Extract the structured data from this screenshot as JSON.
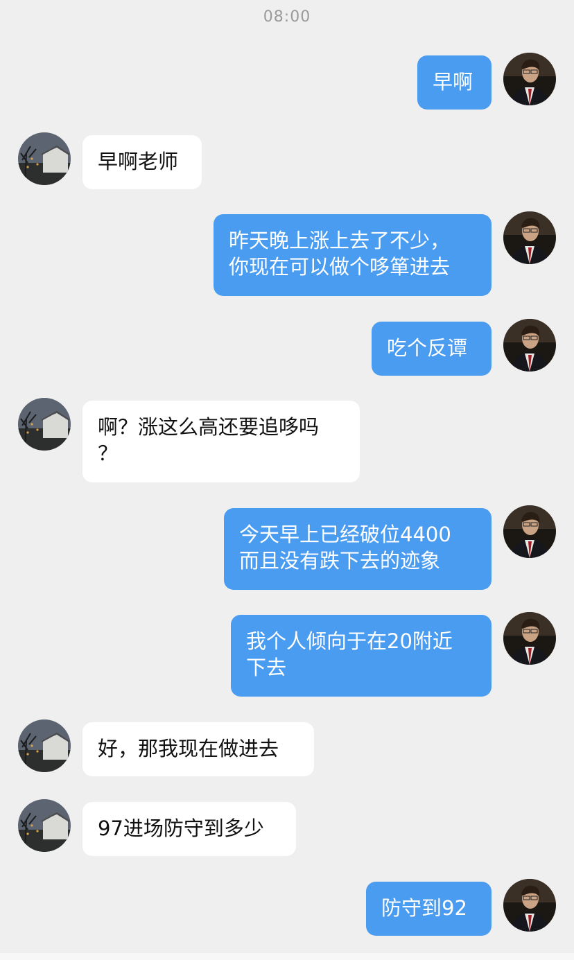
{
  "header": {
    "time": "08:00"
  },
  "colors": {
    "background": "#efefef",
    "outgoing_bubble": "#4a9cf0",
    "incoming_bubble": "#ffffff"
  },
  "avatars": {
    "self": "man-in-suit-avatar",
    "contact": "house-at-dusk-avatar"
  },
  "messages": [
    {
      "side": "out",
      "text": "早啊"
    },
    {
      "side": "in",
      "text": "早啊老师"
    },
    {
      "side": "out",
      "text": "昨天晚上涨上去了不少，\n你现在可以做个哆箪进去"
    },
    {
      "side": "out",
      "text": "吃个反谭"
    },
    {
      "side": "in",
      "text": "啊？涨这么高还要追哆吗\n？"
    },
    {
      "side": "out",
      "text": "今天早上已经破位4400\n而且没有跌下去的迹象"
    },
    {
      "side": "out",
      "text": "我个人倾向于在20附近\n下去"
    },
    {
      "side": "in",
      "text": "好，那我现在做进去"
    },
    {
      "side": "in",
      "text": "97进场防守到多少"
    },
    {
      "side": "out",
      "text": "防守到92"
    }
  ]
}
